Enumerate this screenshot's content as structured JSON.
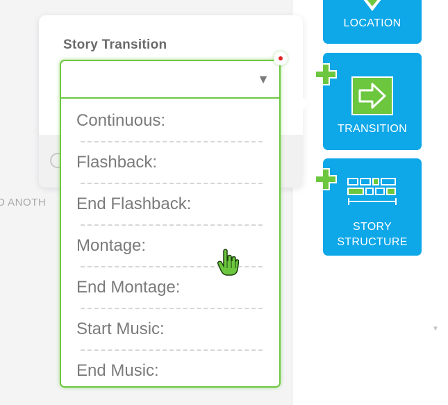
{
  "background": {
    "partial_text": "D ANOTH"
  },
  "popup": {
    "title": "Story Transition"
  },
  "dropdown": {
    "selected_value": "",
    "options": [
      "Continuous:",
      "Flashback:",
      "End Flashback:",
      "Montage:",
      "End Montage:",
      "Start Music:",
      "End Music:"
    ]
  },
  "tiles": {
    "location": {
      "label": "LOCATION"
    },
    "transition": {
      "label": "TRANSITION"
    },
    "story_structure": {
      "label_line1": "STORY",
      "label_line2": "STRUCTURE"
    }
  },
  "colors": {
    "tile_blue": "#0ea7e8",
    "accent_green": "#6cc73f",
    "indicator_red": "#e02424"
  },
  "icons": {
    "location": "map-pin-icon",
    "transition": "arrow-right-box-icon",
    "story_structure": "timeline-blocks-icon",
    "add": "plus-icon",
    "cursor": "hand-pointer-icon"
  }
}
